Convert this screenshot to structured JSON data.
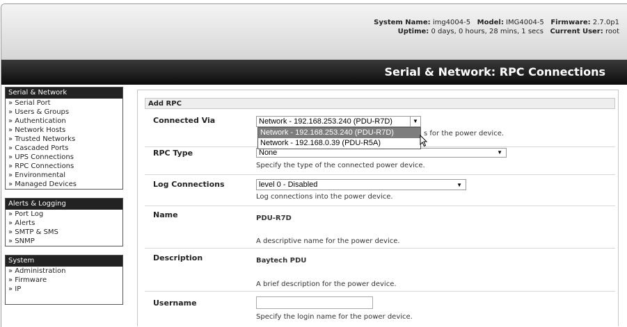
{
  "header": {
    "system_name_label": "System Name:",
    "system_name": "img4004-5",
    "model_label": "Model:",
    "model": "IMG4004-5",
    "firmware_label": "Firmware:",
    "firmware": "2.7.0p1",
    "uptime_label": "Uptime:",
    "uptime": "0 days, 0 hours, 28 mins, 1 secs",
    "current_user_label": "Current User:",
    "current_user": "root",
    "page_title": "Serial & Network: RPC Connections"
  },
  "sidebar": {
    "sections": [
      {
        "title": "Serial & Network",
        "items": [
          "» Serial Port",
          "» Users & Groups",
          "» Authentication",
          "» Network Hosts",
          "» Trusted Networks",
          "» Cascaded Ports",
          "» UPS Connections",
          "» RPC Connections",
          "» Environmental",
          "» Managed Devices"
        ]
      },
      {
        "title": "Alerts & Logging",
        "items": [
          "» Port Log",
          "» Alerts",
          "» SMTP & SMS",
          "» SNMP"
        ]
      },
      {
        "title": "System",
        "items": [
          "» Administration",
          "» Firmware",
          "» IP"
        ]
      }
    ]
  },
  "form": {
    "section_title": "Add RPC",
    "connected_via": {
      "label": "Connected Via",
      "selected": "Network - 192.168.253.240 (PDU-R7D)",
      "help_suffix": "s for the power device.",
      "options": [
        "Network - 192.168.253.240 (PDU-R7D)",
        "Network - 192.168.0.39 (PDU-R5A)"
      ]
    },
    "rpc_type": {
      "label": "RPC Type",
      "selected": "None",
      "help": "Specify the type of the connected power device."
    },
    "log_connections": {
      "label": "Log Connections",
      "selected": "level 0 - Disabled",
      "help": "Log connections into the power device."
    },
    "name": {
      "label": "Name",
      "value": "PDU-R7D",
      "help": "A descriptive name for the power device."
    },
    "description": {
      "label": "Description",
      "value": "Baytech PDU",
      "help": "A brief description for the power device."
    },
    "username": {
      "label": "Username",
      "value": "",
      "help": "Specify the login name for the power device."
    }
  }
}
